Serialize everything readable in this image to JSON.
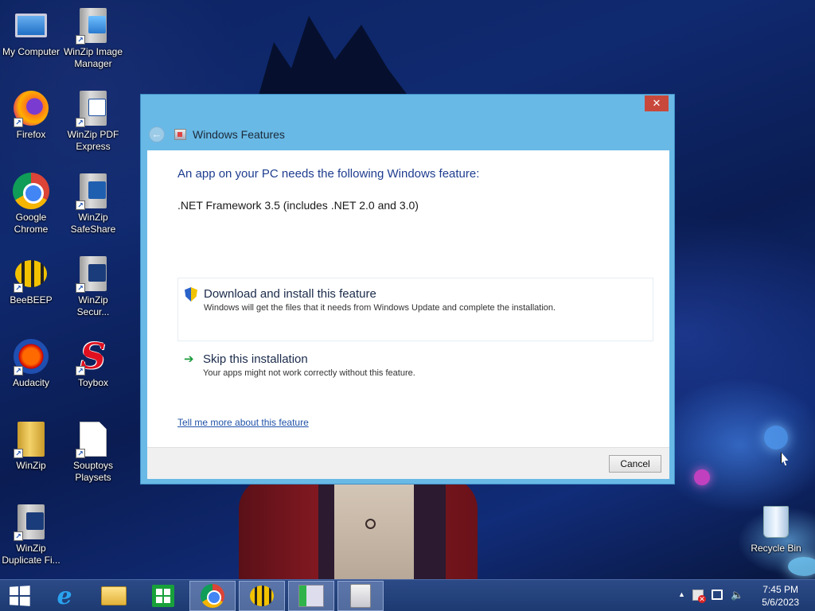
{
  "desktop": {
    "icons_left": [
      {
        "label": "My Computer",
        "icon": "computer-icon"
      },
      {
        "label": "Firefox",
        "icon": "firefox-icon"
      },
      {
        "label": "Google Chrome",
        "icon": "chrome-icon"
      },
      {
        "label": "BeeBEEP",
        "icon": "beebeep-icon"
      },
      {
        "label": "Audacity",
        "icon": "audacity-icon"
      },
      {
        "label": "WinZip",
        "icon": "winzip-icon"
      },
      {
        "label": "WinZip Duplicate Fi...",
        "icon": "winzip-duplicate-icon"
      }
    ],
    "icons_right": [
      {
        "label": "WinZip Image Manager",
        "icon": "winzip-image-icon"
      },
      {
        "label": "WinZip PDF Express",
        "icon": "winzip-pdf-icon"
      },
      {
        "label": "WinZip SafeShare",
        "icon": "winzip-safeshare-icon"
      },
      {
        "label": "WinZip Secur...",
        "icon": "winzip-secure-icon"
      },
      {
        "label": "Toybox",
        "icon": "toybox-icon"
      },
      {
        "label": "Souptoys Playsets",
        "icon": "document-icon"
      }
    ],
    "recycle_bin": {
      "label": "Recycle Bin",
      "icon": "recycle-bin-icon"
    }
  },
  "dialog": {
    "title": "Windows Features",
    "heading": "An app on your PC needs the following Windows feature:",
    "feature_name": ".NET Framework 3.5 (includes .NET 2.0 and 3.0)",
    "options": [
      {
        "title": "Download and install this feature",
        "description": "Windows will get the files that it needs from Windows Update and complete the installation.",
        "icon": "shield-icon"
      },
      {
        "title": "Skip this installation",
        "description": "Your apps might not work correctly without this feature.",
        "icon": "green-arrow-icon"
      }
    ],
    "learn_more_link": "Tell me more about this feature",
    "cancel_label": "Cancel",
    "close_glyph": "✕",
    "back_glyph": "←"
  },
  "taskbar": {
    "items": [
      {
        "name": "start",
        "icon": "windows-start-icon"
      },
      {
        "name": "internet-explorer",
        "icon": "internet-explorer-icon",
        "glyph": "e"
      },
      {
        "name": "file-explorer",
        "icon": "folder-icon"
      },
      {
        "name": "store",
        "icon": "store-icon"
      },
      {
        "name": "chrome",
        "icon": "chrome-icon"
      },
      {
        "name": "beebeep",
        "icon": "beebeep-icon"
      },
      {
        "name": "task-manager",
        "icon": "task-manager-icon"
      },
      {
        "name": "windows-features",
        "icon": "windows-features-icon"
      }
    ],
    "tray": {
      "chevron": "▲",
      "volume_glyph": "🔈",
      "time": "7:45 PM",
      "date": "5/6/2023"
    }
  },
  "colors": {
    "dialog_frame": "#69b9e6",
    "close_button": "#c9483c",
    "heading_text": "#1e3d8f",
    "link_text": "#2152a8",
    "taskbar": "#1d3a72"
  }
}
